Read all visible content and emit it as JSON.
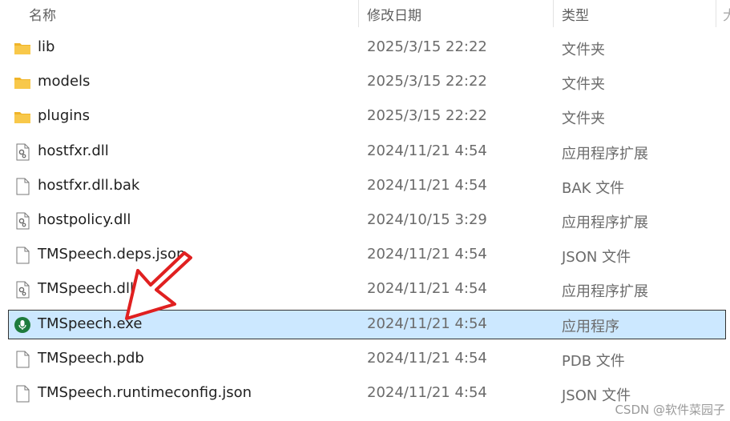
{
  "columns": {
    "name": "名称",
    "date": "修改日期",
    "type": "类型",
    "extra": "大"
  },
  "files": [
    {
      "name": "lib",
      "date": "2025/3/15 22:22",
      "type": "文件夹",
      "icon": "folder-icon"
    },
    {
      "name": "models",
      "date": "2025/3/15 22:22",
      "type": "文件夹",
      "icon": "folder-icon"
    },
    {
      "name": "plugins",
      "date": "2025/3/15 22:22",
      "type": "文件夹",
      "icon": "folder-icon"
    },
    {
      "name": "hostfxr.dll",
      "date": "2024/11/21 4:54",
      "type": "应用程序扩展",
      "icon": "dll-file-icon"
    },
    {
      "name": "hostfxr.dll.bak",
      "date": "2024/11/21 4:54",
      "type": "BAK 文件",
      "icon": "blank-file-icon"
    },
    {
      "name": "hostpolicy.dll",
      "date": "2024/10/15 3:29",
      "type": "应用程序扩展",
      "icon": "dll-file-icon"
    },
    {
      "name": "TMSpeech.deps.json",
      "date": "2024/11/21 4:54",
      "type": "JSON 文件",
      "icon": "blank-file-icon"
    },
    {
      "name": "TMSpeech.dll",
      "date": "2024/11/21 4:54",
      "type": "应用程序扩展",
      "icon": "dll-file-icon"
    },
    {
      "name": "TMSpeech.exe",
      "date": "2024/11/21 4:54",
      "type": "应用程序",
      "icon": "microphone-app-icon",
      "selected": true
    },
    {
      "name": "TMSpeech.pdb",
      "date": "2024/11/21 4:54",
      "type": "PDB 文件",
      "icon": "blank-file-icon"
    },
    {
      "name": "TMSpeech.runtimeconfig.json",
      "date": "2024/11/21 4:54",
      "type": "JSON 文件",
      "icon": "blank-file-icon"
    }
  ],
  "annotation": {
    "icon": "red-arrow-icon",
    "color": "#e02020"
  },
  "watermark": "CSDN @软件菜园子",
  "colors": {
    "selection": "#cce8ff",
    "folder": "#f8c84a",
    "app_icon": "#1e7b3c"
  }
}
